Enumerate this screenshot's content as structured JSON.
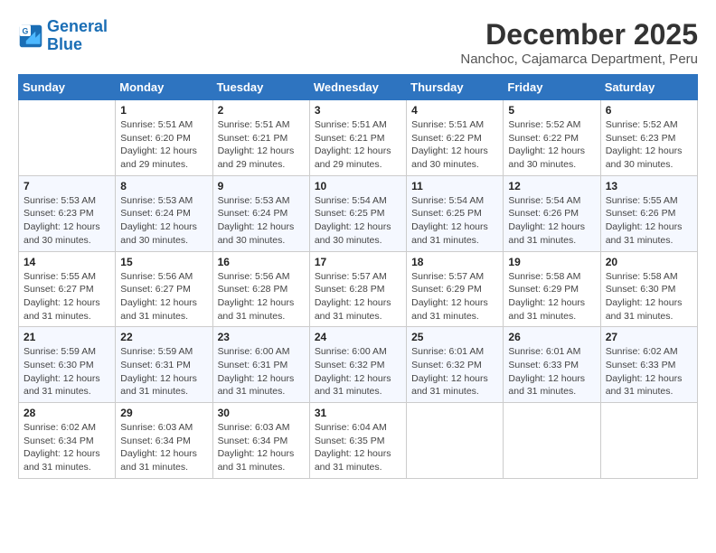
{
  "logo": {
    "line1": "General",
    "line2": "Blue"
  },
  "title": "December 2025",
  "subtitle": "Nanchoc, Cajamarca Department, Peru",
  "headers": [
    "Sunday",
    "Monday",
    "Tuesday",
    "Wednesday",
    "Thursday",
    "Friday",
    "Saturday"
  ],
  "weeks": [
    [
      {
        "day": "",
        "info": ""
      },
      {
        "day": "1",
        "info": "Sunrise: 5:51 AM\nSunset: 6:20 PM\nDaylight: 12 hours and 29 minutes."
      },
      {
        "day": "2",
        "info": "Sunrise: 5:51 AM\nSunset: 6:21 PM\nDaylight: 12 hours and 29 minutes."
      },
      {
        "day": "3",
        "info": "Sunrise: 5:51 AM\nSunset: 6:21 PM\nDaylight: 12 hours and 29 minutes."
      },
      {
        "day": "4",
        "info": "Sunrise: 5:51 AM\nSunset: 6:22 PM\nDaylight: 12 hours and 30 minutes."
      },
      {
        "day": "5",
        "info": "Sunrise: 5:52 AM\nSunset: 6:22 PM\nDaylight: 12 hours and 30 minutes."
      },
      {
        "day": "6",
        "info": "Sunrise: 5:52 AM\nSunset: 6:23 PM\nDaylight: 12 hours and 30 minutes."
      }
    ],
    [
      {
        "day": "7",
        "info": "Sunrise: 5:53 AM\nSunset: 6:23 PM\nDaylight: 12 hours and 30 minutes."
      },
      {
        "day": "8",
        "info": "Sunrise: 5:53 AM\nSunset: 6:24 PM\nDaylight: 12 hours and 30 minutes."
      },
      {
        "day": "9",
        "info": "Sunrise: 5:53 AM\nSunset: 6:24 PM\nDaylight: 12 hours and 30 minutes."
      },
      {
        "day": "10",
        "info": "Sunrise: 5:54 AM\nSunset: 6:25 PM\nDaylight: 12 hours and 30 minutes."
      },
      {
        "day": "11",
        "info": "Sunrise: 5:54 AM\nSunset: 6:25 PM\nDaylight: 12 hours and 31 minutes."
      },
      {
        "day": "12",
        "info": "Sunrise: 5:54 AM\nSunset: 6:26 PM\nDaylight: 12 hours and 31 minutes."
      },
      {
        "day": "13",
        "info": "Sunrise: 5:55 AM\nSunset: 6:26 PM\nDaylight: 12 hours and 31 minutes."
      }
    ],
    [
      {
        "day": "14",
        "info": "Sunrise: 5:55 AM\nSunset: 6:27 PM\nDaylight: 12 hours and 31 minutes."
      },
      {
        "day": "15",
        "info": "Sunrise: 5:56 AM\nSunset: 6:27 PM\nDaylight: 12 hours and 31 minutes."
      },
      {
        "day": "16",
        "info": "Sunrise: 5:56 AM\nSunset: 6:28 PM\nDaylight: 12 hours and 31 minutes."
      },
      {
        "day": "17",
        "info": "Sunrise: 5:57 AM\nSunset: 6:28 PM\nDaylight: 12 hours and 31 minutes."
      },
      {
        "day": "18",
        "info": "Sunrise: 5:57 AM\nSunset: 6:29 PM\nDaylight: 12 hours and 31 minutes."
      },
      {
        "day": "19",
        "info": "Sunrise: 5:58 AM\nSunset: 6:29 PM\nDaylight: 12 hours and 31 minutes."
      },
      {
        "day": "20",
        "info": "Sunrise: 5:58 AM\nSunset: 6:30 PM\nDaylight: 12 hours and 31 minutes."
      }
    ],
    [
      {
        "day": "21",
        "info": "Sunrise: 5:59 AM\nSunset: 6:30 PM\nDaylight: 12 hours and 31 minutes."
      },
      {
        "day": "22",
        "info": "Sunrise: 5:59 AM\nSunset: 6:31 PM\nDaylight: 12 hours and 31 minutes."
      },
      {
        "day": "23",
        "info": "Sunrise: 6:00 AM\nSunset: 6:31 PM\nDaylight: 12 hours and 31 minutes."
      },
      {
        "day": "24",
        "info": "Sunrise: 6:00 AM\nSunset: 6:32 PM\nDaylight: 12 hours and 31 minutes."
      },
      {
        "day": "25",
        "info": "Sunrise: 6:01 AM\nSunset: 6:32 PM\nDaylight: 12 hours and 31 minutes."
      },
      {
        "day": "26",
        "info": "Sunrise: 6:01 AM\nSunset: 6:33 PM\nDaylight: 12 hours and 31 minutes."
      },
      {
        "day": "27",
        "info": "Sunrise: 6:02 AM\nSunset: 6:33 PM\nDaylight: 12 hours and 31 minutes."
      }
    ],
    [
      {
        "day": "28",
        "info": "Sunrise: 6:02 AM\nSunset: 6:34 PM\nDaylight: 12 hours and 31 minutes."
      },
      {
        "day": "29",
        "info": "Sunrise: 6:03 AM\nSunset: 6:34 PM\nDaylight: 12 hours and 31 minutes."
      },
      {
        "day": "30",
        "info": "Sunrise: 6:03 AM\nSunset: 6:34 PM\nDaylight: 12 hours and 31 minutes."
      },
      {
        "day": "31",
        "info": "Sunrise: 6:04 AM\nSunset: 6:35 PM\nDaylight: 12 hours and 31 minutes."
      },
      {
        "day": "",
        "info": ""
      },
      {
        "day": "",
        "info": ""
      },
      {
        "day": "",
        "info": ""
      }
    ]
  ]
}
